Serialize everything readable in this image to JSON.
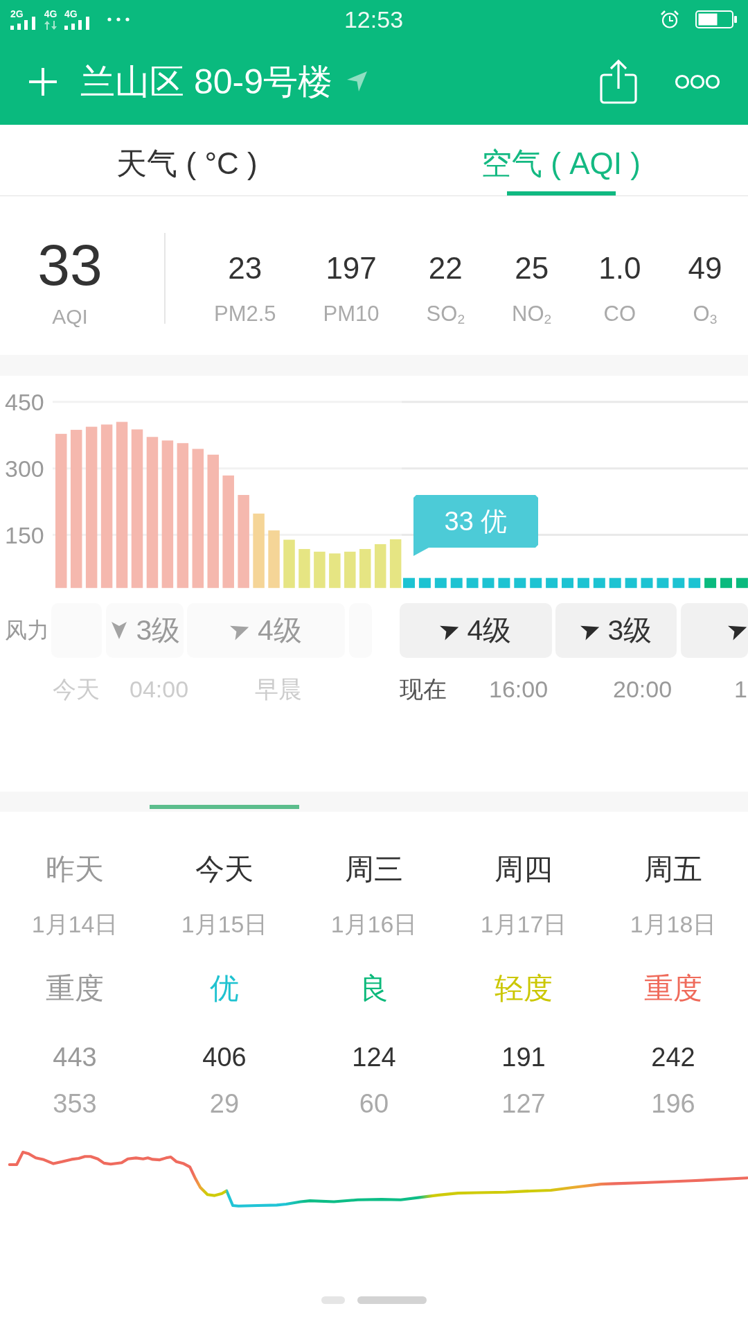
{
  "status_bar": {
    "networks": [
      {
        "label": "2G",
        "kind": "signal"
      },
      {
        "label": "4G",
        "kind": "data"
      },
      {
        "label": "4G",
        "kind": "signal"
      }
    ],
    "time": "12:53"
  },
  "header": {
    "title": "兰山区 80-9号楼"
  },
  "tabs": [
    {
      "label": "天气 ( °C )",
      "selected": false
    },
    {
      "label": "空气 ( AQI )",
      "selected": true
    }
  ],
  "aqi": {
    "value": "33",
    "label": "AQI"
  },
  "pollutants": [
    {
      "value": "23",
      "name": "PM2.5"
    },
    {
      "value": "197",
      "name": "PM10"
    },
    {
      "value": "22",
      "name": "SO$_{2}$"
    },
    {
      "value": "25",
      "name": "NO$_{2}$"
    },
    {
      "value": "1.0",
      "name": "CO"
    },
    {
      "value": "49",
      "name": "O$_{3}$"
    }
  ],
  "hourly": {
    "chart_data": {
      "type": "bar",
      "stacked": true,
      "ylim": [
        30,
        450
      ],
      "yticks": [
        150,
        300,
        450
      ],
      "series": [
        {
          "color": "#f5b8ae",
          "values": [
            378,
            387,
            394,
            399,
            405,
            388,
            371,
            363,
            357,
            344,
            331,
            284,
            240,
            null,
            null,
            null,
            null,
            null,
            null,
            null,
            null,
            null,
            null
          ]
        },
        {
          "color": "#f5d597",
          "values": [
            null,
            null,
            null,
            null,
            null,
            null,
            null,
            null,
            null,
            null,
            null,
            null,
            null,
            198,
            160,
            null,
            null,
            null,
            null,
            null,
            null,
            null,
            null
          ]
        },
        {
          "color": "#e6e583",
          "values": [
            null,
            null,
            null,
            null,
            null,
            null,
            null,
            null,
            null,
            null,
            null,
            null,
            null,
            null,
            null,
            139,
            118,
            112,
            108,
            112,
            118,
            129,
            140
          ]
        }
      ]
    },
    "forecast_blocks": [
      {
        "color": "#1dc3d2"
      },
      {
        "color": "#1dc3d2"
      },
      {
        "color": "#1dc3d2"
      },
      {
        "color": "#1dc3d2"
      },
      {
        "color": "#1dc3d2"
      },
      {
        "color": "#1dc3d2"
      },
      {
        "color": "#1dc3d2"
      },
      {
        "color": "#1dc3d2"
      },
      {
        "color": "#1dc3d2"
      },
      {
        "color": "#1dc3d2"
      },
      {
        "color": "#1dc3d2"
      },
      {
        "color": "#1dc3d2"
      },
      {
        "color": "#1dc3d2"
      },
      {
        "color": "#1dc3d2"
      },
      {
        "color": "#1dc3d2"
      },
      {
        "color": "#1dc3d2"
      },
      {
        "color": "#1dc3d2"
      },
      {
        "color": "#1dc3d2"
      },
      {
        "color": "#1dc3d2"
      },
      {
        "color": "#0aba7e"
      },
      {
        "color": "#0aba7e"
      },
      {
        "color": "#0aba7e"
      }
    ],
    "tooltip": "33 优",
    "wind_label": "风力",
    "wind_past": [
      {
        "kind": "empty"
      },
      {
        "kind": "down",
        "force": "3级"
      },
      {
        "kind": "right",
        "force": "4级"
      },
      {
        "kind": "empty"
      }
    ],
    "wind_ahead": [
      {
        "kind": "right",
        "force": "4级"
      },
      {
        "kind": "right",
        "force": "3级"
      },
      {
        "kind": "right"
      }
    ],
    "times": [
      {
        "label": "今天",
        "kind": "past"
      },
      {
        "label": "04:00",
        "kind": "past"
      },
      {
        "label": "早晨",
        "kind": "past"
      },
      {
        "label": "现在",
        "kind": "now"
      },
      {
        "label": "16:00",
        "kind": "future"
      },
      {
        "label": "20:00",
        "kind": "future"
      },
      {
        "label": "1",
        "kind": "future"
      }
    ]
  },
  "days": [
    {
      "name": "昨天",
      "date": "1月14日",
      "quality": "重度",
      "color": "#9a9a9a",
      "high": "443",
      "low": "353",
      "past": true,
      "selected": false
    },
    {
      "name": "今天",
      "date": "1月15日",
      "quality": "优",
      "color": "#1fc2d0",
      "high": "406",
      "low": "29",
      "past": false,
      "selected": true
    },
    {
      "name": "周三",
      "date": "1月16日",
      "quality": "良",
      "color": "#0cb97b",
      "high": "124",
      "low": "60",
      "past": false,
      "selected": false
    },
    {
      "name": "周四",
      "date": "1月17日",
      "quality": "轻度",
      "color": "#cbc700",
      "high": "191",
      "low": "127",
      "past": false,
      "selected": false
    },
    {
      "name": "周五",
      "date": "1月18日",
      "quality": "重度",
      "color": "#ef6a5a",
      "high": "242",
      "low": "196",
      "past": false,
      "selected": false
    }
  ],
  "pages": [
    {
      "selected": false
    },
    {
      "selected": true
    }
  ]
}
